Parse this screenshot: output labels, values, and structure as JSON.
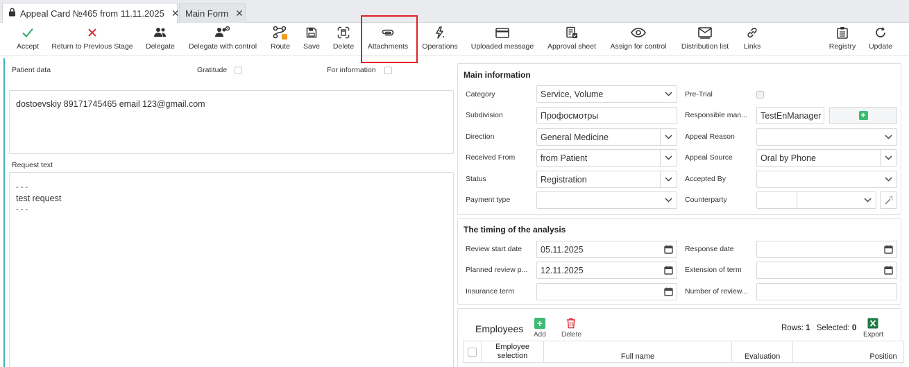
{
  "tabs": [
    {
      "label": "Appeal Card №465 from 11.11.2025",
      "icon": "lock-icon",
      "active": true
    },
    {
      "label": "Main Form",
      "active": false
    }
  ],
  "toolbar": {
    "accept": "Accept",
    "return_prev": "Return to Previous Stage",
    "delegate": "Delegate",
    "delegate_control": "Delegate with control",
    "route": "Route",
    "save": "Save",
    "delete": "Delete",
    "attachments": "Attachments",
    "operations": "Operations",
    "uploaded_message": "Uploaded message",
    "approval_sheet": "Approval sheet",
    "assign_control": "Assign for control",
    "distribution_list": "Distribution list",
    "links": "Links",
    "registry": "Registry",
    "update": "Update",
    "route_badge": "!"
  },
  "left": {
    "patient_data_label": "Patient data",
    "gratitude_label": "Gratitude",
    "for_information_label": "For information",
    "patient_text": "dostoevskiy 89171745465 email 123@gmail.com",
    "request_text_label": "Request text",
    "request_lines": [
      " - - -",
      "test request",
      " - - -"
    ]
  },
  "main_info": {
    "title": "Main information",
    "category_label": "Category",
    "category_value": "Service, Volume",
    "pretrial_label": "Pre-Trial",
    "subdivision_label": "Subdivision",
    "subdivision_value": "Профосмотры",
    "responsible_label": "Responsible man...",
    "responsible_value": "TestEnManager",
    "direction_label": "Direction",
    "direction_value": "General Medicine",
    "appeal_reason_label": "Appeal Reason",
    "appeal_reason_value": "",
    "received_from_label": "Received From",
    "received_from_value": "from Patient",
    "appeal_source_label": "Appeal Source",
    "appeal_source_value": "Oral by Phone",
    "status_label": "Status",
    "status_value": "Registration",
    "accepted_by_label": "Accepted By",
    "accepted_by_value": "",
    "payment_type_label": "Payment type",
    "payment_type_value": "",
    "counterparty_label": "Counterparty",
    "counterparty_value": ""
  },
  "timing": {
    "title": "The timing of the analysis",
    "review_start_label": "Review start date",
    "review_start_value": "05.11.2025",
    "response_date_label": "Response date",
    "response_date_value": "",
    "planned_review_label": "Planned review p...",
    "planned_review_value": "12.11.2025",
    "extension_label": "Extension of term",
    "extension_value": "",
    "insurance_label": "Insurance term",
    "insurance_value": "",
    "number_review_label": "Number of review...",
    "number_review_value": ""
  },
  "employees": {
    "title": "Employees",
    "add_label": "Add",
    "delete_label": "Delete",
    "rows_label": "Rows:",
    "rows_value": "1",
    "selected_label": "Selected:",
    "selected_value": "0",
    "export_label": "Export",
    "columns": [
      "Employee selection",
      "Full name",
      "Evaluation",
      "Position"
    ]
  },
  "colors": {
    "accent_teal": "#3fb3b8",
    "accept_green": "#2ea86a",
    "reject_red": "#e0303a",
    "highlight_red": "#e0202a",
    "add_green": "#3dbb72",
    "excel_green": "#1f7a44"
  }
}
